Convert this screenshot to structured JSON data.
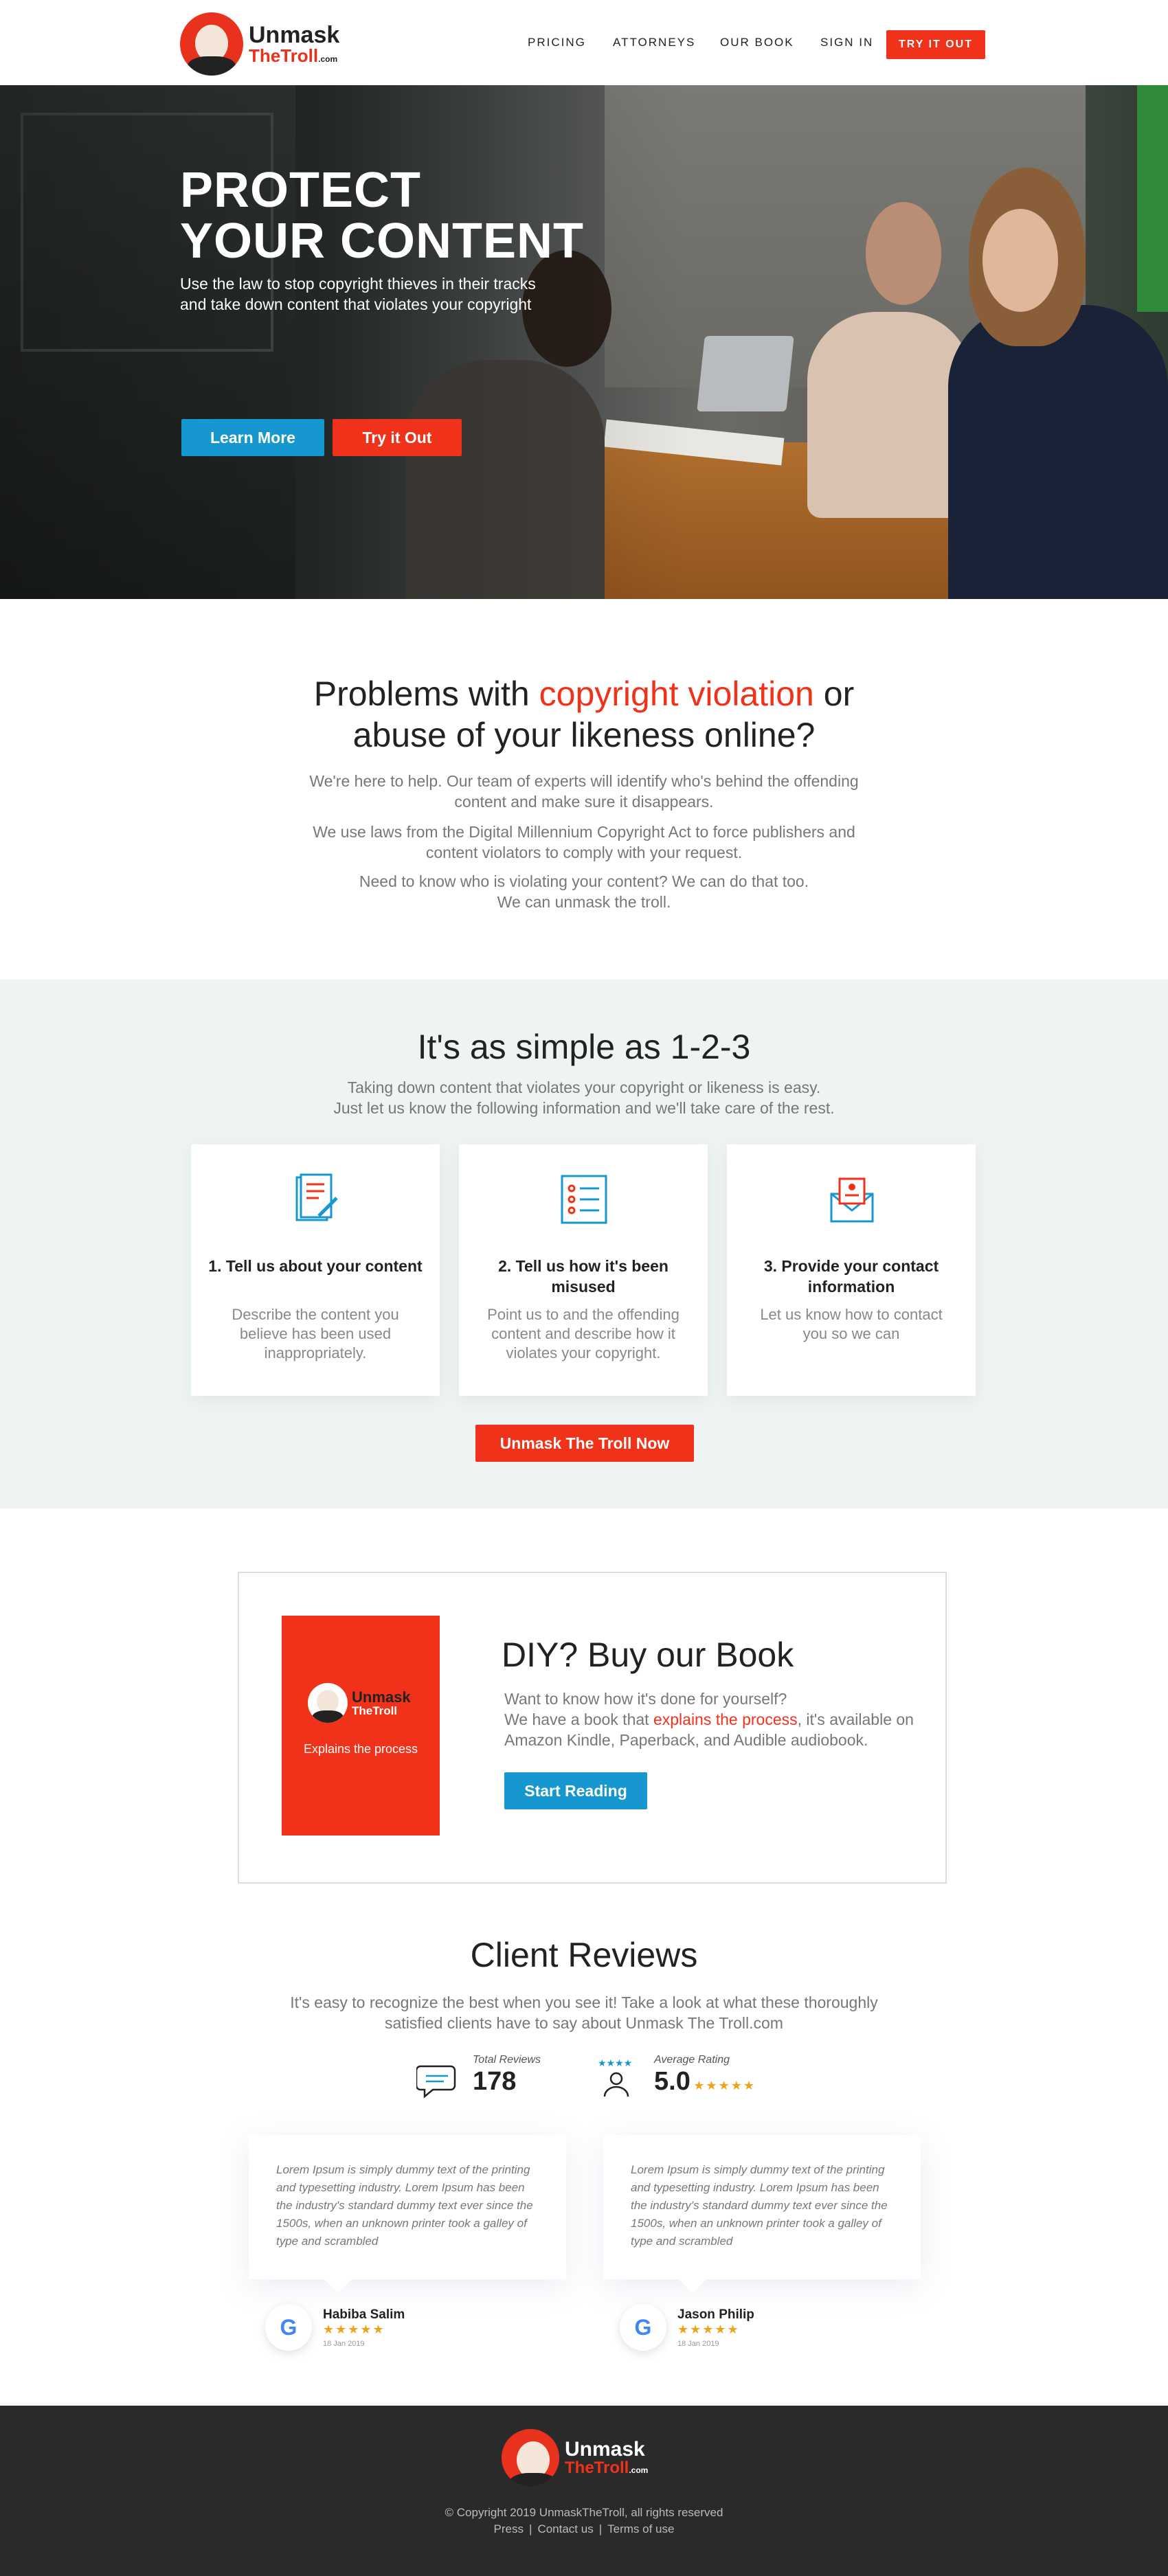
{
  "brand": {
    "name_line1": "Unmask",
    "name_line2": "TheTroll",
    "name_suffix": ".com",
    "accent": "#f0321a",
    "blue": "#1797cf"
  },
  "nav": {
    "items": [
      "PRICING",
      "ATTORNEYS",
      "OUR BOOK",
      "SIGN IN"
    ],
    "cta": "TRY IT OUT"
  },
  "hero": {
    "title_line1": "PROTECT",
    "title_line2": "YOUR CONTENT",
    "subtitle": "Use the law to stop copyright thieves in their tracks and take down content that violates your copyright",
    "learn_more": "Learn More",
    "try_it_out": "Try it Out"
  },
  "problems": {
    "heading_pre": "Problems with ",
    "heading_highlight": "copyright violation",
    "heading_post1": " or",
    "heading_line2": "abuse of your likeness online?",
    "p1": "We're here to help. Our team of experts will identify who's behind the offending content and make sure it disappears.",
    "p2": "We use laws from the Digital Millennium Copyright Act to force publishers and content violators to comply with your request.",
    "p3_line1": "Need to know who is violating your content? We can do that too.",
    "p3_line2": "We can unmask the troll."
  },
  "steps": {
    "heading": "It's as simple as 1-2-3",
    "sub_line1": "Taking down content that violates your copyright or likeness is easy.",
    "sub_line2": "Just let us know the following information and we'll take care of the rest.",
    "cards": [
      {
        "icon": "document-pen-icon",
        "title": "1. Tell us about your content",
        "text": "Describe the content you believe has been used inappropriately."
      },
      {
        "icon": "checklist-icon",
        "title": "2. Tell us how it's been misused",
        "text": "Point us to and the offending content and describe how it violates your copyright."
      },
      {
        "icon": "envelope-contact-icon",
        "title": "3. Provide your contact information",
        "text": "Let us know how to contact you so we can"
      }
    ],
    "cta": "Unmask The Troll Now"
  },
  "book": {
    "cover_tag": "Explains the process",
    "heading": "DIY? Buy our Book",
    "line1": "Want to know how it's done for yourself?",
    "line2_pre": "We have a book that ",
    "line2_highlight": "explains the process",
    "line2_post": ", it's available on Amazon Kindle, Paperback, and Audible audiobook.",
    "cta": "Start Reading"
  },
  "reviews": {
    "heading": "Client Reviews",
    "sub": "It's easy to recognize the best when you see it! Take a look at what these thoroughly satisfied clients have to say about Unmask The Troll.com",
    "total_label": "Total Reviews",
    "total_value": "178",
    "avg_label": "Average Rating",
    "avg_value": "5.0",
    "avg_stars": "★★★★★",
    "items": [
      {
        "text": "Lorem Ipsum is simply dummy text of the printing and typesetting industry. Lorem Ipsum has been the industry's standard dummy text ever since the 1500s, when an unknown printer took a galley of type and scrambled",
        "name": "Habiba Salim",
        "stars": "★★★★★",
        "date": "18 Jan 2019",
        "source": "G"
      },
      {
        "text": "Lorem Ipsum is simply dummy text of the printing and typesetting industry. Lorem Ipsum has been the industry's standard dummy text ever since the 1500s, when an unknown printer took a galley of type and scrambled",
        "name": "Jason Philip",
        "stars": "★★★★★",
        "date": "18 Jan 2019",
        "source": "G"
      }
    ]
  },
  "footer": {
    "copyright": "© Copyright 2019 UnmaskTheTroll, all rights reserved",
    "links": [
      "Press",
      "Contact us",
      "Terms of use"
    ],
    "separator": "|"
  }
}
